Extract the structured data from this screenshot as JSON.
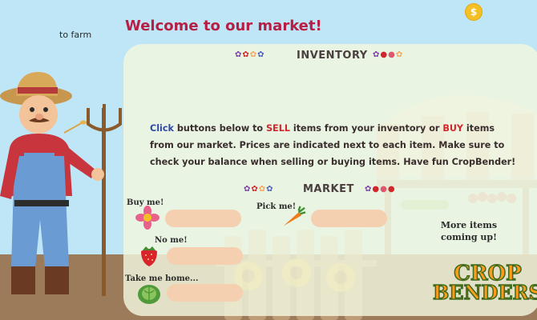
{
  "nav": {
    "to_farm": "to farm"
  },
  "coin": {
    "symbol": "$"
  },
  "title": "Welcome to our market!",
  "inventory": {
    "heading": "INVENTORY"
  },
  "instructions": {
    "part1": "Click",
    "part2": " buttons below to ",
    "part3": "SELL",
    "part4": " items from your inventory or ",
    "part5": "BUY",
    "part6": " items from our market. Prices are indicated next to each item. Make sure to check your balance when selling or buying items. Have fun CropBender!"
  },
  "market": {
    "heading": "MARKET",
    "items": [
      {
        "label": "Buy me!",
        "icon": "flower-icon"
      },
      {
        "label": "Pick me!",
        "icon": "carrot-icon"
      },
      {
        "label": "No me!",
        "icon": "strawberry-icon"
      },
      {
        "label": "Take me home...",
        "icon": "cabbage-icon"
      }
    ],
    "more": "More items coming up!"
  },
  "logo": {
    "line1": "CROP",
    "line2": "BENDERS"
  },
  "colors": {
    "title": "#b71e43",
    "click": "#2e4aa6",
    "sell_buy": "#d3262c",
    "price_bar": "#f5d0b0",
    "logo_fill": "#ff9a1a",
    "logo_stroke": "#3b6b1e"
  }
}
